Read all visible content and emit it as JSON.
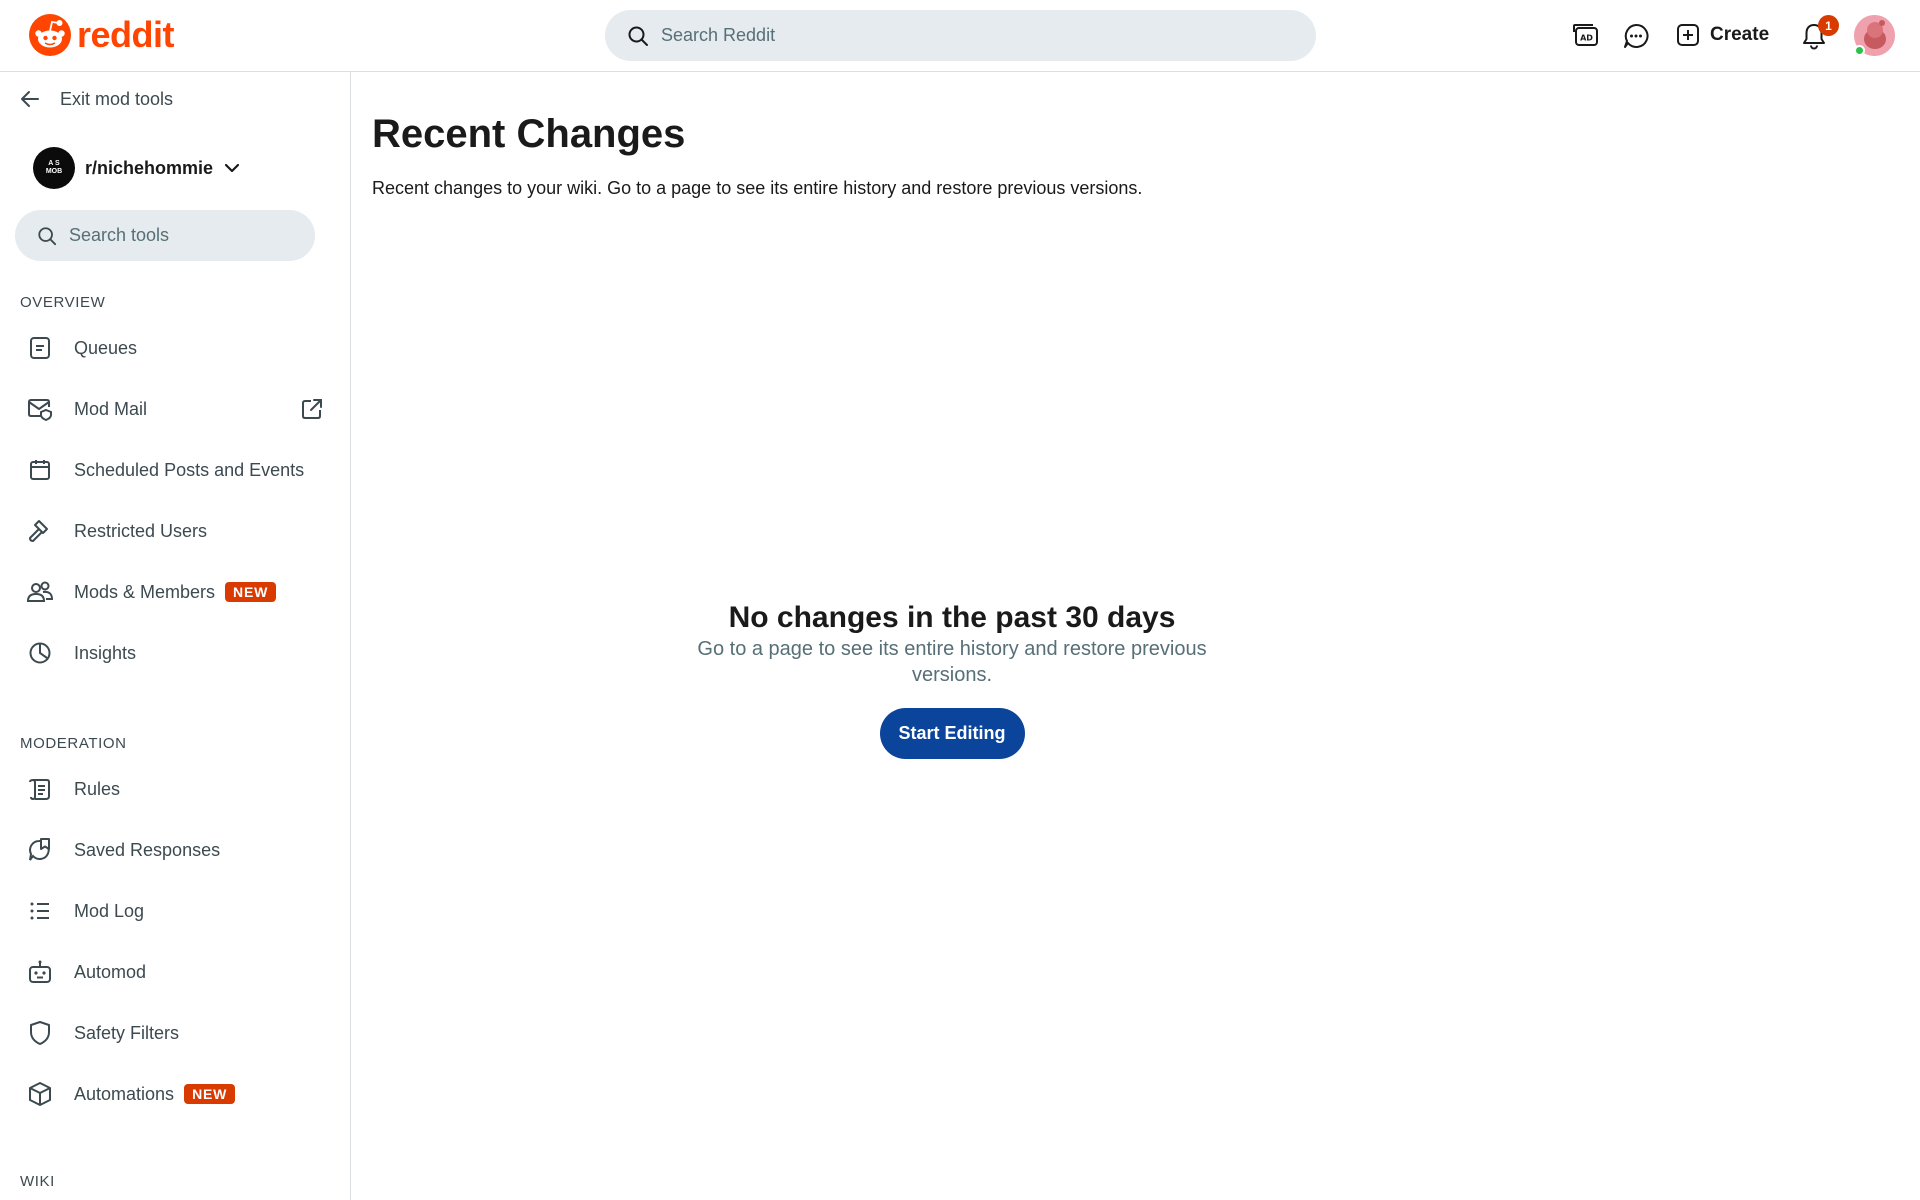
{
  "header": {
    "logo_text": "reddit",
    "search_placeholder": "Search Reddit",
    "create_label": "Create",
    "notification_count": "1",
    "brand_color": "#ff4500"
  },
  "sidebar": {
    "exit_label": "Exit mod tools",
    "subreddit": {
      "name": "r/nichehommie",
      "avatar_text_top": "A S",
      "avatar_text_bottom": "MOB"
    },
    "search_placeholder": "Search tools",
    "sections": {
      "overview": "OVERVIEW",
      "moderation": "MODERATION",
      "wiki": "WIKI"
    },
    "overview_items": [
      {
        "label": "Queues",
        "icon": "queue-icon"
      },
      {
        "label": "Mod Mail",
        "icon": "mod-mail-icon"
      },
      {
        "label": "Scheduled Posts and Events",
        "icon": "calendar-icon"
      },
      {
        "label": "Restricted Users",
        "icon": "hammer-icon"
      },
      {
        "label": "Mods & Members",
        "icon": "members-icon",
        "badge": "NEW"
      },
      {
        "label": "Insights",
        "icon": "pie-chart-icon"
      }
    ],
    "moderation_items": [
      {
        "label": "Rules",
        "icon": "rules-icon"
      },
      {
        "label": "Saved Responses",
        "icon": "saved-responses-icon"
      },
      {
        "label": "Mod Log",
        "icon": "list-icon"
      },
      {
        "label": "Automod",
        "icon": "robot-icon"
      },
      {
        "label": "Safety Filters",
        "icon": "shield-icon"
      },
      {
        "label": "Automations",
        "icon": "cube-icon",
        "badge": "NEW"
      }
    ]
  },
  "main": {
    "title": "Recent Changes",
    "description": "Recent changes to your wiki. Go to a page to see its entire history and restore previous versions.",
    "empty_state": {
      "title": "No changes in the past 30 days",
      "description": "Go to a page to see its entire history and restore previous versions.",
      "button_label": "Start Editing",
      "button_color": "#0a449b"
    }
  }
}
